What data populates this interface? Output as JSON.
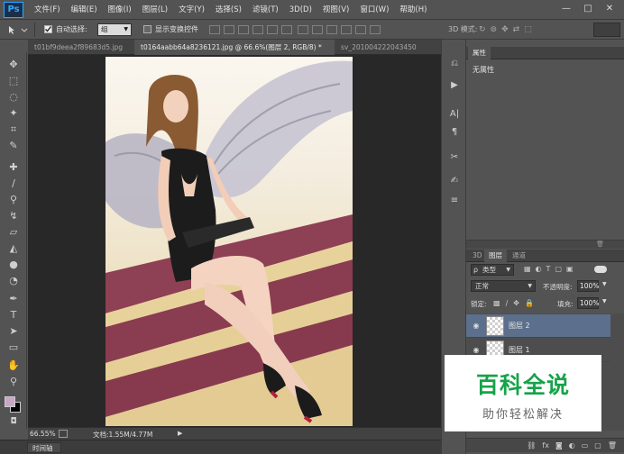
{
  "app": {
    "logo": "Ps"
  },
  "menu": [
    "文件(F)",
    "编辑(E)",
    "图像(I)",
    "图层(L)",
    "文字(Y)",
    "选择(S)",
    "滤镜(T)",
    "3D(D)",
    "视图(V)",
    "窗口(W)",
    "帮助(H)"
  ],
  "window_controls": {
    "minimize": "—",
    "maximize": "□",
    "close": "✕"
  },
  "options_bar": {
    "auto_select_label": "自动选择:",
    "auto_select_value": "组",
    "transform_controls_label": "显示变换控件",
    "mode_3d_label": "3D 模式:"
  },
  "tabs": [
    {
      "label": "t01bf9deea2f89683d5.jpg",
      "active": false
    },
    {
      "label": "t0164aabb64a8236121.jpg @ 66.6%(图层 2, RGB/8) *",
      "active": true
    },
    {
      "label": "sv_201004222043450",
      "active": false
    }
  ],
  "status": {
    "zoom": "66.55%",
    "doc": "文档:1.55M/4.77M"
  },
  "timeline": {
    "label": "时间轴"
  },
  "properties_panel": {
    "tab": "属性",
    "content": "无属性"
  },
  "layers_panel": {
    "tabs": [
      "3D",
      "图层",
      "通道"
    ],
    "active_tab": "图层",
    "filter": "类型",
    "blend_mode": "正常",
    "opacity_label": "不透明度:",
    "opacity_value": "100%",
    "lock_label": "锁定:",
    "fill_label": "填充:",
    "fill_value": "100%",
    "layers": [
      {
        "name": "图层 2",
        "selected": true
      },
      {
        "name": "图层 1",
        "selected": false
      }
    ]
  },
  "watermark": {
    "title": "百科全说",
    "subtitle": "助你轻松解决"
  },
  "colors": {
    "foreground": "#c9a5c6",
    "background": "#000000",
    "selection": "#5c6f8c",
    "watermark_green": "#16a34a"
  }
}
